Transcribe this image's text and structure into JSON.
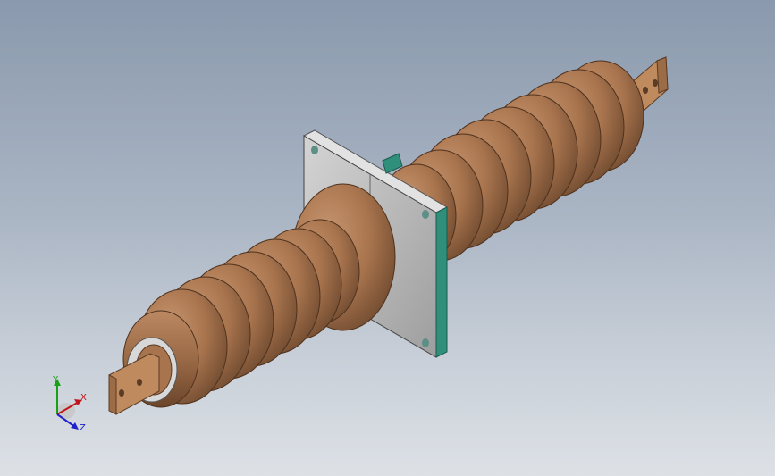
{
  "viewport": {
    "background_top": "#8a99ad",
    "background_bottom": "#dde1e6"
  },
  "model": {
    "porcelain_color": "#a8744e",
    "terminal_color": "#b88459",
    "flange_color": "#c4c4c4",
    "gasket_color": "#2f8f7a"
  },
  "triad": {
    "x_label": "X",
    "y_label": "Y",
    "z_label": "Z",
    "x_color": "#c0151b",
    "y_color": "#18a018",
    "z_color": "#1e22c8"
  }
}
